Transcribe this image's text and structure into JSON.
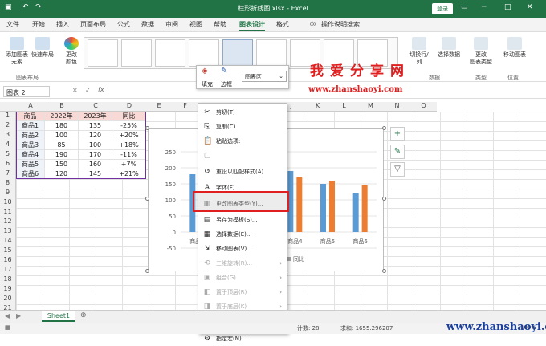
{
  "title": "柱形折线图.xlsx - Excel",
  "login": "登录",
  "tabs": [
    "文件",
    "开始",
    "插入",
    "页面布局",
    "公式",
    "数据",
    "审阅",
    "视图",
    "帮助",
    "图表设计",
    "格式",
    "操作说明搜索"
  ],
  "share": "共享",
  "ribbon": {
    "add_element": "添加图表\n元素",
    "quick_layout": "快速布局",
    "change_color": "更改\n颜色",
    "group_layout": "图表布局",
    "switch_rowcol": "切换行/列",
    "select_data": "选择数据",
    "group_data": "数据",
    "change_type": "更改\n图表类型",
    "group_type": "类型",
    "move_chart": "移动图表",
    "group_loc": "位置"
  },
  "fmt": {
    "fill": "填充",
    "border": "边框",
    "dropdown": "图表区"
  },
  "watermark": "我爱分享网",
  "watermark_url": "www.zhanshaoyi.com",
  "namebox": "图表 2",
  "cols": [
    "A",
    "B",
    "C",
    "D",
    "E",
    "F",
    "G",
    "H",
    "I",
    "J",
    "K",
    "L",
    "M",
    "N",
    "O"
  ],
  "rows": [
    "1",
    "2",
    "3",
    "4",
    "5",
    "6",
    "7",
    "8",
    "9",
    "10",
    "11",
    "12",
    "13",
    "14",
    "15",
    "16",
    "17",
    "18",
    "19",
    "20",
    "21"
  ],
  "table": {
    "headers": [
      "商品",
      "2022年",
      "2023年",
      "同比"
    ],
    "rows": [
      [
        "商品1",
        "180",
        "135",
        "-25%"
      ],
      [
        "商品2",
        "100",
        "120",
        "+20%"
      ],
      [
        "商品3",
        "85",
        "100",
        "+18%"
      ],
      [
        "商品4",
        "190",
        "170",
        "-11%"
      ],
      [
        "商品5",
        "150",
        "160",
        "+7%"
      ],
      [
        "商品6",
        "120",
        "145",
        "+21%"
      ]
    ]
  },
  "menu": [
    {
      "label": "剪切(T)",
      "icon": "cut-icon",
      "dis": false
    },
    {
      "label": "复制(C)",
      "icon": "copy-icon",
      "dis": false
    },
    {
      "label": "粘贴选项:",
      "icon": "paste-icon",
      "dis": false
    },
    {
      "label": "",
      "icon": "paste-blank-icon",
      "dis": true
    },
    {
      "label": "重设以匹配样式(A)",
      "icon": "reset-icon",
      "dis": false
    },
    {
      "label": "字体(F)...",
      "icon": "font-icon",
      "dis": false
    },
    {
      "label": "更改图表类型(Y)...",
      "icon": "chart-type-icon",
      "dis": false
    },
    {
      "label": "另存为模板(S)...",
      "icon": "template-icon",
      "dis": false
    },
    {
      "label": "选择数据(E)...",
      "icon": "select-data-icon",
      "dis": false
    },
    {
      "label": "移动图表(V)...",
      "icon": "move-chart-icon",
      "dis": false
    },
    {
      "label": "三维旋转(R)...",
      "icon": "rotate-3d-icon",
      "dis": true
    },
    {
      "label": "组合(G)",
      "icon": "group-icon",
      "dis": true
    },
    {
      "label": "置于顶层(R)",
      "icon": "bring-front-icon",
      "dis": true
    },
    {
      "label": "置于底层(K)",
      "icon": "send-back-icon",
      "dis": true
    },
    {
      "label": "另存为图片(S)...",
      "icon": "save-picture-icon",
      "dis": false
    },
    {
      "label": "指定宏(N)...",
      "icon": "macro-icon",
      "dis": false
    }
  ],
  "chart_data": {
    "type": "bar",
    "categories": [
      "商品1",
      "商品2",
      "商品3",
      "商品4",
      "商品5",
      "商品6"
    ],
    "series": [
      {
        "name": "2022年",
        "values": [
          180,
          100,
          85,
          190,
          150,
          120
        ],
        "color": "#5b9bd5"
      },
      {
        "name": "2023年",
        "values": [
          135,
          120,
          100,
          170,
          160,
          145
        ],
        "color": "#ed7d31"
      },
      {
        "name": "同比",
        "values": [
          -0.25,
          0.2,
          0.18,
          -0.11,
          0.07,
          0.21
        ],
        "color": "#a5a5a5"
      }
    ],
    "y_ticks": [
      "250",
      "200",
      "150",
      "100",
      "50",
      "0",
      "-50"
    ],
    "ylim": [
      -50,
      250
    ],
    "legend_visible": "同比"
  },
  "sheet": "Sheet1",
  "status": {
    "count": "计数: 28",
    "sum": "求和: 1655.296207",
    "zoom": "100%"
  }
}
